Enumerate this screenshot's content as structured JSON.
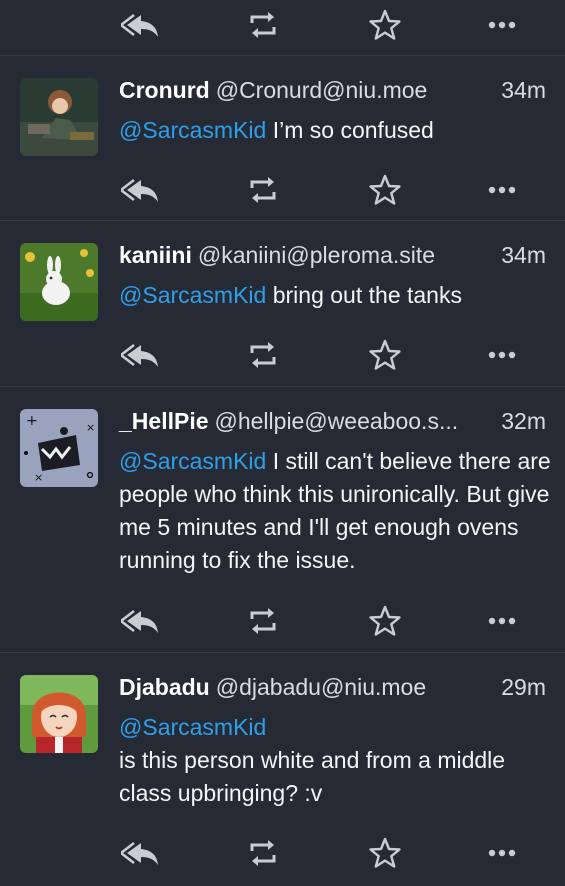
{
  "colors": {
    "background": "#262a34",
    "mention": "#2ea0ea",
    "icon": "#c9ccd3",
    "divider": "#353a46"
  },
  "icons": {
    "reply": "reply-all-icon",
    "repeat": "repeat-icon",
    "favorite": "star-icon",
    "more": "more-dots-icon"
  },
  "posts": [
    {
      "display_name": "Cronurd",
      "handle": "@Cronurd@niu.moe",
      "time": "34m",
      "mention": "@SarcasmKid",
      "text": "I’m so confused"
    },
    {
      "display_name": "kaniini",
      "handle": "@kaniini@pleroma.site",
      "time": "34m",
      "mention": "@SarcasmKid",
      "text": "bring out the tanks"
    },
    {
      "display_name": "_HellPie",
      "handle": "@hellpie@weeaboo.s...",
      "time": "32m",
      "mention": "@SarcasmKid",
      "text": "I still can't believe there are people who think this unironically. But give me 5 minutes and I'll get enough ovens running to fix the issue."
    },
    {
      "display_name": "Djabadu",
      "handle": "@djabadu@niu.moe",
      "time": "29m",
      "mention": "@SarcasmKid",
      "text": "is this person white and from a middle class upbringing? :v"
    }
  ]
}
